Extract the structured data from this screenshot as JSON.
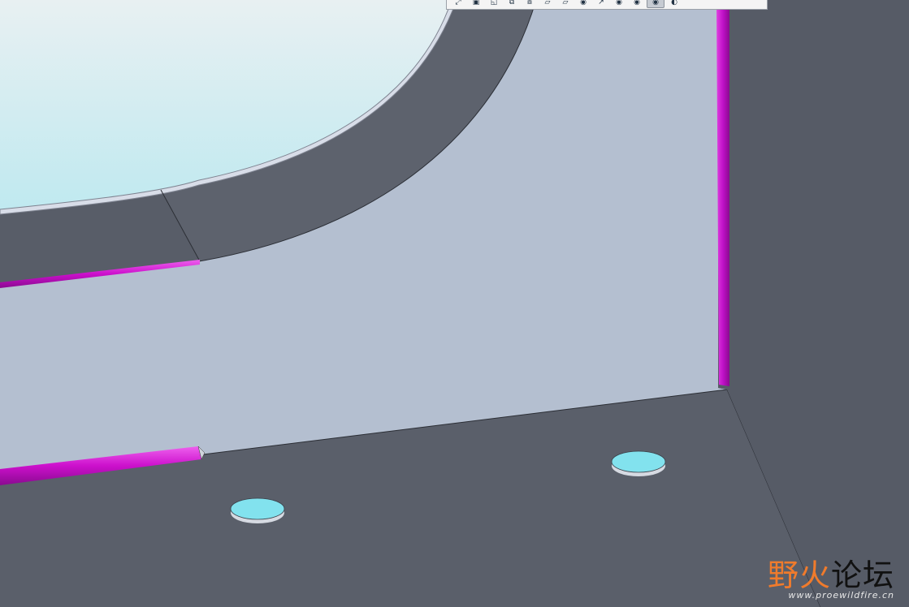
{
  "toolbar": {
    "buttons": [
      {
        "name": "zoom-to-fit",
        "glyph": "⤢"
      },
      {
        "name": "repaint",
        "glyph": "▣"
      },
      {
        "name": "orient",
        "glyph": "◱"
      },
      {
        "name": "saved-views",
        "glyph": "⧉"
      },
      {
        "name": "display-style",
        "glyph": "⧇"
      },
      {
        "name": "datum-planes",
        "glyph": "▱"
      },
      {
        "name": "datum-axes",
        "glyph": "▱"
      },
      {
        "name": "show-points",
        "glyph": "◉"
      },
      {
        "name": "show-csys",
        "glyph": "↗"
      },
      {
        "name": "show-annotations",
        "glyph": "◉"
      },
      {
        "name": "show-spin-center",
        "glyph": "◉"
      },
      {
        "name": "visibility",
        "glyph": "◉"
      },
      {
        "name": "appearance",
        "glyph": "◐"
      }
    ]
  },
  "watermark": {
    "part1": "野火",
    "part2": "论坛",
    "url": "www.proewildfire.cn"
  },
  "colors": {
    "background": "#5a5f6a",
    "panel": "#b4bfd0",
    "window_glass": "#c9eaf0",
    "edge_strip": "#cc10cc",
    "holes": "#82e2ee"
  }
}
